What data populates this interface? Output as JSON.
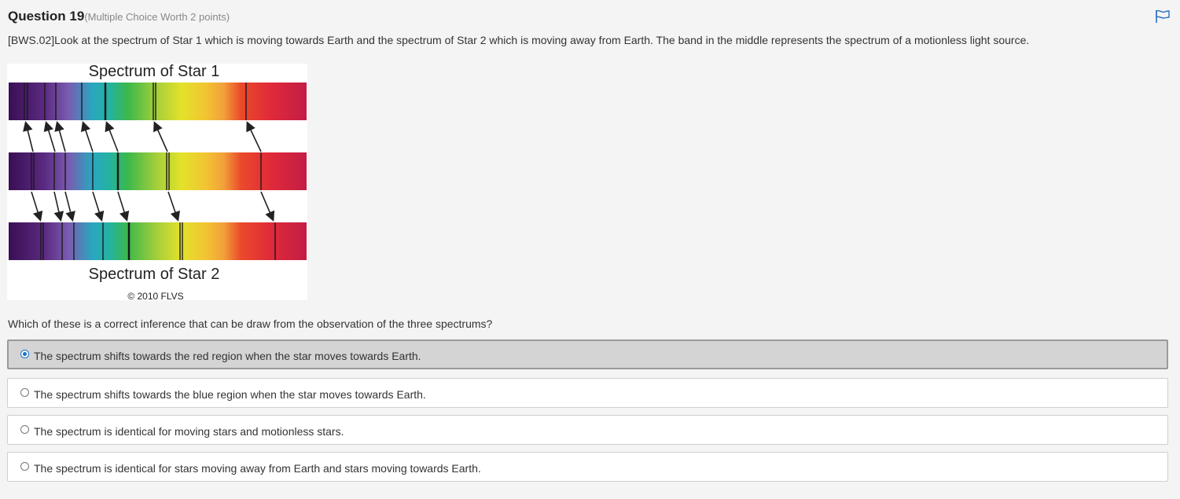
{
  "question": {
    "title": "Question 19",
    "worth": "(Multiple Choice Worth 2 points)",
    "prompt": "[BWS.02]Look at the spectrum of Star 1 which is moving towards Earth and the spectrum of Star 2 which is moving away from Earth. The band in the middle represents the spectrum of a motionless light source.",
    "inference_question": "Which of these is a correct inference that can be draw from the observation of the three spectrums?"
  },
  "figure": {
    "top_title": "Spectrum of Star 1",
    "bottom_title": "Spectrum of Star 2",
    "copyright": "© 2010 FLVS"
  },
  "options": [
    {
      "label": "The spectrum shifts towards the red region when the star moves towards Earth.",
      "selected": true
    },
    {
      "label": "The spectrum shifts towards the blue region when the star moves towards Earth.",
      "selected": false
    },
    {
      "label": "The spectrum is identical for moving stars and motionless stars.",
      "selected": false
    },
    {
      "label": "The spectrum is identical for stars moving away from Earth and stars moving towards Earth.",
      "selected": false
    }
  ],
  "icons": {
    "flag": "flag-icon"
  },
  "colors": {
    "accent": "#1a73c8",
    "selected_bg": "#d4d4d4"
  }
}
